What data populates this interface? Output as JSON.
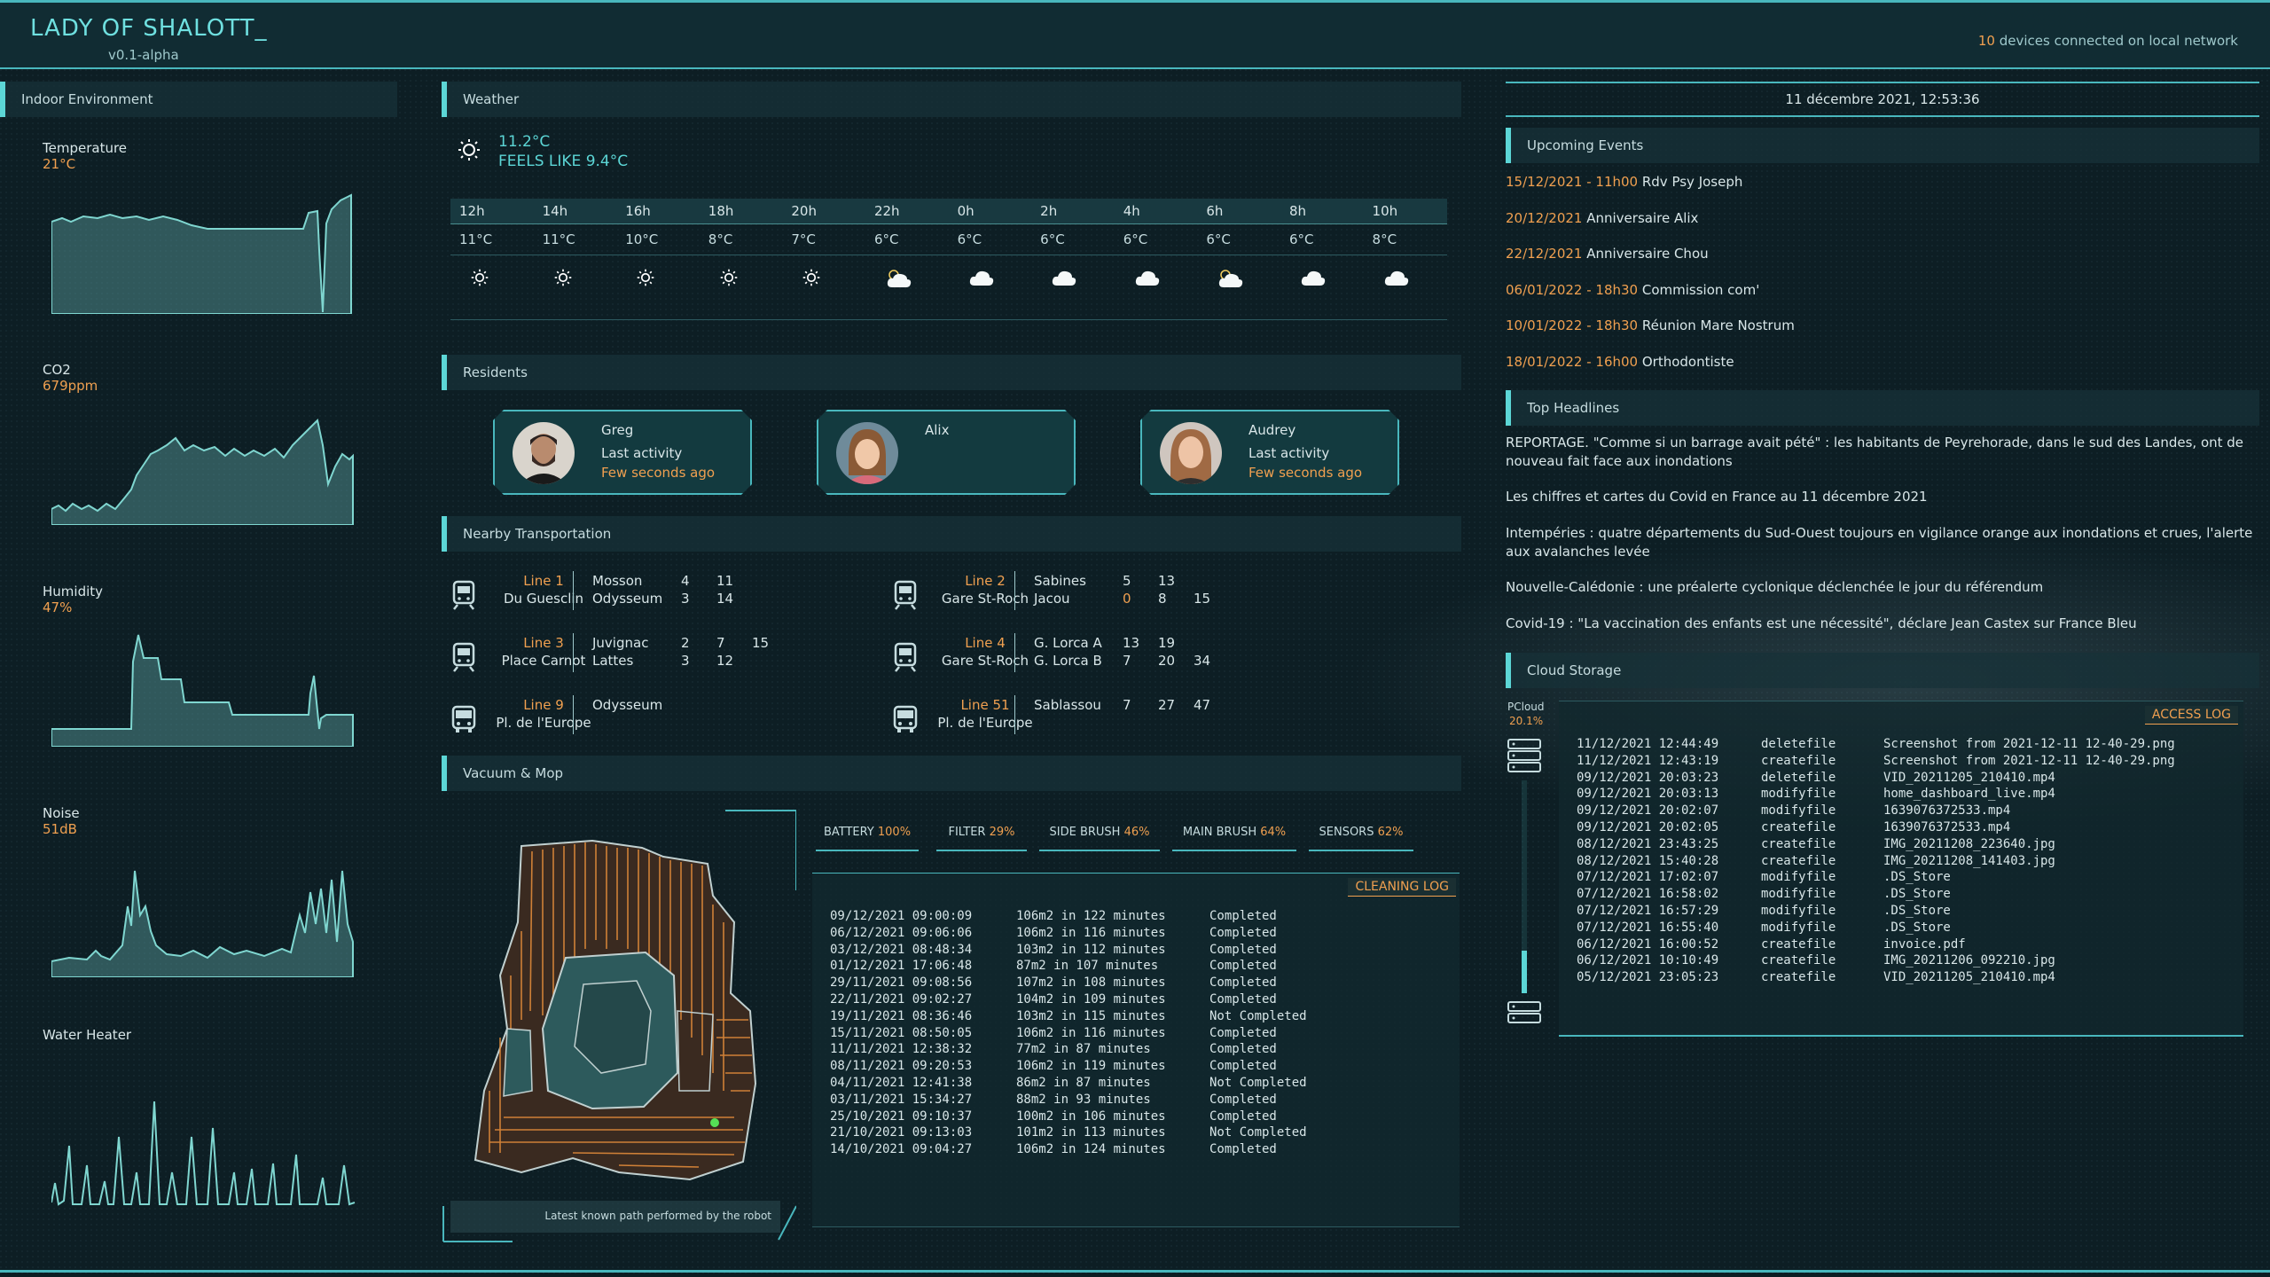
{
  "header": {
    "title": "LADY OF SHALOTT_",
    "version": "v0.1-alpha",
    "devices_count": "10",
    "devices_text": " devices connected on local network"
  },
  "indoor": {
    "title": "Indoor Environment",
    "metrics": [
      {
        "label": "Temperature",
        "value": "21°C"
      },
      {
        "label": "CO2",
        "value": "679ppm"
      },
      {
        "label": "Humidity",
        "value": "47%"
      },
      {
        "label": "Noise",
        "value": "51dB"
      },
      {
        "label": "Water Heater",
        "value": ""
      }
    ]
  },
  "weather": {
    "title": "Weather",
    "temp": "11.2°C",
    "feels": "FEELS LIKE 9.4°C",
    "hours": [
      "12h",
      "14h",
      "16h",
      "18h",
      "20h",
      "22h",
      "0h",
      "2h",
      "4h",
      "6h",
      "8h",
      "10h"
    ],
    "temps": [
      "11°C",
      "11°C",
      "10°C",
      "8°C",
      "7°C",
      "6°C",
      "6°C",
      "6°C",
      "6°C",
      "6°C",
      "6°C",
      "8°C"
    ],
    "icons": [
      "sun-icon",
      "sun-icon",
      "sun-icon",
      "sun-icon",
      "sun-icon",
      "partly-cloudy-icon",
      "cloud-icon",
      "cloud-icon",
      "cloud-icon",
      "partly-cloudy-icon",
      "cloud-icon",
      "cloud-icon"
    ]
  },
  "residents": {
    "title": "Residents",
    "people": [
      {
        "name": "Greg",
        "activity": "Last activity",
        "time": "Few seconds ago"
      },
      {
        "name": "Alix",
        "activity": "",
        "time": ""
      },
      {
        "name": "Audrey",
        "activity": "Last activity",
        "time": "Few seconds ago"
      }
    ]
  },
  "transport": {
    "title": "Nearby Transportation",
    "lines": [
      {
        "line": "Line 1",
        "stop": "Du Guesclin",
        "icon": "tram-icon",
        "dest": [
          {
            "name": "Mosson",
            "times": [
              "4",
              "11",
              ""
            ]
          },
          {
            "name": "Odysseum",
            "times": [
              "3",
              "14",
              ""
            ]
          }
        ]
      },
      {
        "line": "Line 2",
        "stop": "Gare St-Roch",
        "icon": "tram-icon",
        "dest": [
          {
            "name": "Sabines",
            "times": [
              "5",
              "13",
              ""
            ]
          },
          {
            "name": "Jacou",
            "times": [
              "0",
              "8",
              "15"
            ]
          }
        ]
      },
      {
        "line": "Line 3",
        "stop": "Place Carnot",
        "icon": "tram-icon",
        "dest": [
          {
            "name": "Juvignac",
            "times": [
              "2",
              "7",
              "15"
            ]
          },
          {
            "name": "Lattes",
            "times": [
              "3",
              "12",
              ""
            ]
          }
        ]
      },
      {
        "line": "Line 4",
        "stop": "Gare St-Roch",
        "icon": "tram-icon",
        "dest": [
          {
            "name": "G. Lorca A",
            "times": [
              "13",
              "19",
              ""
            ]
          },
          {
            "name": "G. Lorca B",
            "times": [
              "7",
              "20",
              "34"
            ]
          }
        ]
      },
      {
        "line": "Line 9",
        "stop": "Pl. de l'Europe",
        "icon": "bus-icon",
        "dest": [
          {
            "name": "Odysseum",
            "times": [
              "",
              "",
              ""
            ]
          }
        ]
      },
      {
        "line": "Line 51",
        "stop": "Pl. de l'Europe",
        "icon": "bus-icon",
        "dest": [
          {
            "name": "Sablassou",
            "times": [
              "7",
              "27",
              "47"
            ]
          }
        ]
      }
    ]
  },
  "vacuum": {
    "title": "Vacuum & Mop",
    "caption": "Latest known path performed by the robot",
    "tabs": [
      {
        "label": "BATTERY ",
        "value": "100%",
        "level": 1.0
      },
      {
        "label": "FILTER ",
        "value": "29%",
        "level": 0.29
      },
      {
        "label": "SIDE BRUSH ",
        "value": "46%",
        "level": 0.46
      },
      {
        "label": "MAIN BRUSH ",
        "value": "64%",
        "level": 0.64
      },
      {
        "label": "SENSORS ",
        "value": "62%",
        "level": 0.62
      }
    ],
    "log_title": "CLEANING LOG",
    "log": [
      [
        "09/12/2021 09:00:09",
        "106m2 in 122 minutes",
        "Completed"
      ],
      [
        "06/12/2021 09:06:06",
        "106m2 in 116 minutes",
        "Completed"
      ],
      [
        "03/12/2021 08:48:34",
        "103m2 in 112 minutes",
        "Completed"
      ],
      [
        "01/12/2021 17:06:48",
        "87m2 in 107 minutes",
        "Completed"
      ],
      [
        "29/11/2021 09:08:56",
        "107m2 in 108 minutes",
        "Completed"
      ],
      [
        "22/11/2021 09:02:27",
        "104m2 in 109 minutes",
        "Completed"
      ],
      [
        "19/11/2021 08:36:46",
        "103m2 in 115 minutes",
        "Not Completed"
      ],
      [
        "15/11/2021 08:50:05",
        "106m2 in 116 minutes",
        "Completed"
      ],
      [
        "11/11/2021 12:38:32",
        "77m2 in 87 minutes",
        "Completed"
      ],
      [
        "08/11/2021 09:20:53",
        "106m2 in 119 minutes",
        "Completed"
      ],
      [
        "04/11/2021 12:41:38",
        "86m2 in 87 minutes",
        "Not Completed"
      ],
      [
        "03/11/2021 15:34:27",
        "88m2 in 93 minutes",
        "Completed"
      ],
      [
        "25/10/2021 09:10:37",
        "100m2 in 106 minutes",
        "Completed"
      ],
      [
        "21/10/2021 09:13:03",
        "101m2 in 113 minutes",
        "Not Completed"
      ],
      [
        "14/10/2021 09:04:27",
        "106m2 in 124 minutes",
        "Completed"
      ]
    ]
  },
  "datetime": "11 décembre 2021, 12:53:36",
  "events": {
    "title": "Upcoming Events",
    "items": [
      {
        "time": "15/12/2021 - 11h00",
        "text": " Rdv Psy Joseph"
      },
      {
        "time": "20/12/2021",
        "text": " Anniversaire Alix"
      },
      {
        "time": "22/12/2021",
        "text": " Anniversaire Chou"
      },
      {
        "time": "06/01/2022 - 18h30",
        "text": " Commission com'"
      },
      {
        "time": "10/01/2022 - 18h30",
        "text": " Réunion Mare Nostrum"
      },
      {
        "time": "18/01/2022 - 16h00",
        "text": " Orthodontiste"
      }
    ]
  },
  "headlines": {
    "title": "Top Headlines",
    "items": [
      "REPORTAGE. \"Comme si un barrage avait pété\" : les habitants de Peyrehorade, dans le sud des Landes, ont de nouveau fait face aux inondations",
      "Les chiffres et cartes du Covid en France au 11 décembre 2021",
      "Intempéries : quatre départements du Sud-Ouest toujours en vigilance orange aux inondations et crues, l'alerte aux avalanches levée",
      "Nouvelle-Calédonie : une préalerte cyclonique déclenchée le jour du référendum",
      "Covid-19 : \"La vaccination des enfants est une nécessité\", déclare Jean Castex sur France Bleu"
    ]
  },
  "cloud": {
    "title": "Cloud Storage",
    "name": "PCloud",
    "usage": "20.1%",
    "log_title": "ACCESS LOG",
    "log": [
      [
        "11/12/2021 12:44:49",
        "deletefile",
        "Screenshot from 2021-12-11 12-40-29.png"
      ],
      [
        "11/12/2021 12:43:19",
        "createfile",
        "Screenshot from 2021-12-11 12-40-29.png"
      ],
      [
        "09/12/2021 20:03:23",
        "deletefile",
        "VID_20211205_210410.mp4"
      ],
      [
        "09/12/2021 20:03:13",
        "modifyfile",
        "home_dashboard_live.mp4"
      ],
      [
        "09/12/2021 20:02:07",
        "modifyfile",
        "1639076372533.mp4"
      ],
      [
        "09/12/2021 20:02:05",
        "createfile",
        "1639076372533.mp4"
      ],
      [
        "08/12/2021 23:43:25",
        "createfile",
        "IMG_20211208_223640.jpg"
      ],
      [
        "08/12/2021 15:40:28",
        "createfile",
        "IMG_20211208_141403.jpg"
      ],
      [
        "07/12/2021 17:02:07",
        "modifyfile",
        ".DS_Store"
      ],
      [
        "07/12/2021 16:58:02",
        "modifyfile",
        ".DS_Store"
      ],
      [
        "07/12/2021 16:57:29",
        "modifyfile",
        ".DS_Store"
      ],
      [
        "07/12/2021 16:55:40",
        "modifyfile",
        ".DS_Store"
      ],
      [
        "06/12/2021 16:00:52",
        "createfile",
        "invoice.pdf"
      ],
      [
        "06/12/2021 10:10:49",
        "createfile",
        "IMG_20211206_092210.jpg"
      ],
      [
        "05/12/2021 23:05:23",
        "createfile",
        "VID_20211205_210410.mp4"
      ]
    ]
  },
  "colors": {
    "accent": "#5cd6d6",
    "highlight": "#f0a050",
    "background": "#0d1e24"
  }
}
